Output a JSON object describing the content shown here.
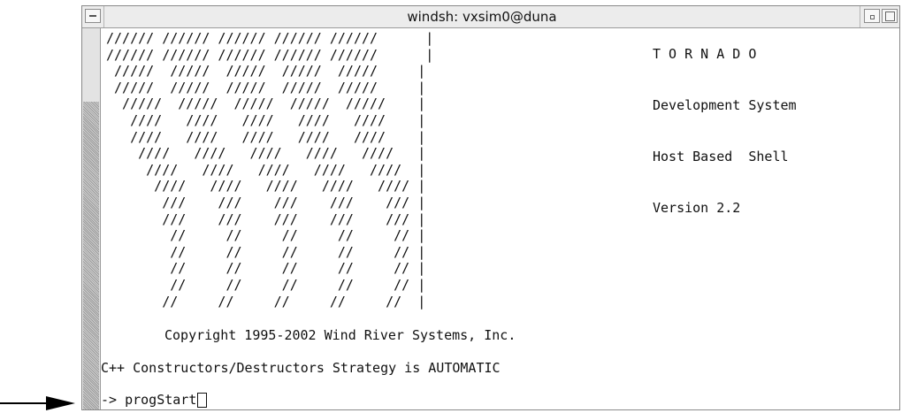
{
  "window": {
    "title": "windsh: vxsim0@duna"
  },
  "banner": {
    "ascii_lines": [
      "////// ////// ////// ////// //////      |",
      "////// ////// ////// ////// //////      |",
      " /////  /////  /////  /////  /////     |",
      " /////  /////  /////  /////  /////     |",
      "  /////  /////  /////  /////  /////    |",
      "   ////   ////   ////   ////   ////    |",
      "   ////   ////   ////   ////   ////    |",
      "    ////   ////   ////   ////   ////   |",
      "     ////   ////   ////   ////   ////  |",
      "      ////   ////   ////   ////   //// |",
      "       ///    ///    ///    ///    /// |",
      "       ///    ///    ///    ///    /// |",
      "        //     //     //     //     // |",
      "        //     //     //     //     // |",
      "        //     //     //     //     // |",
      "        //     //     //     //     // |",
      "       //     //     //     //     //  |"
    ],
    "product_name": "T O R N A D O",
    "subtitle": "Development System",
    "shell_type": "Host Based  Shell",
    "version": "Version 2.2"
  },
  "copyright": "Copyright 1995-2002 Wind River Systems, Inc.",
  "strategy_line": "C++ Constructors/Destructors Strategy is AUTOMATIC",
  "prompt": {
    "symbol": "->",
    "command": "progStart"
  }
}
